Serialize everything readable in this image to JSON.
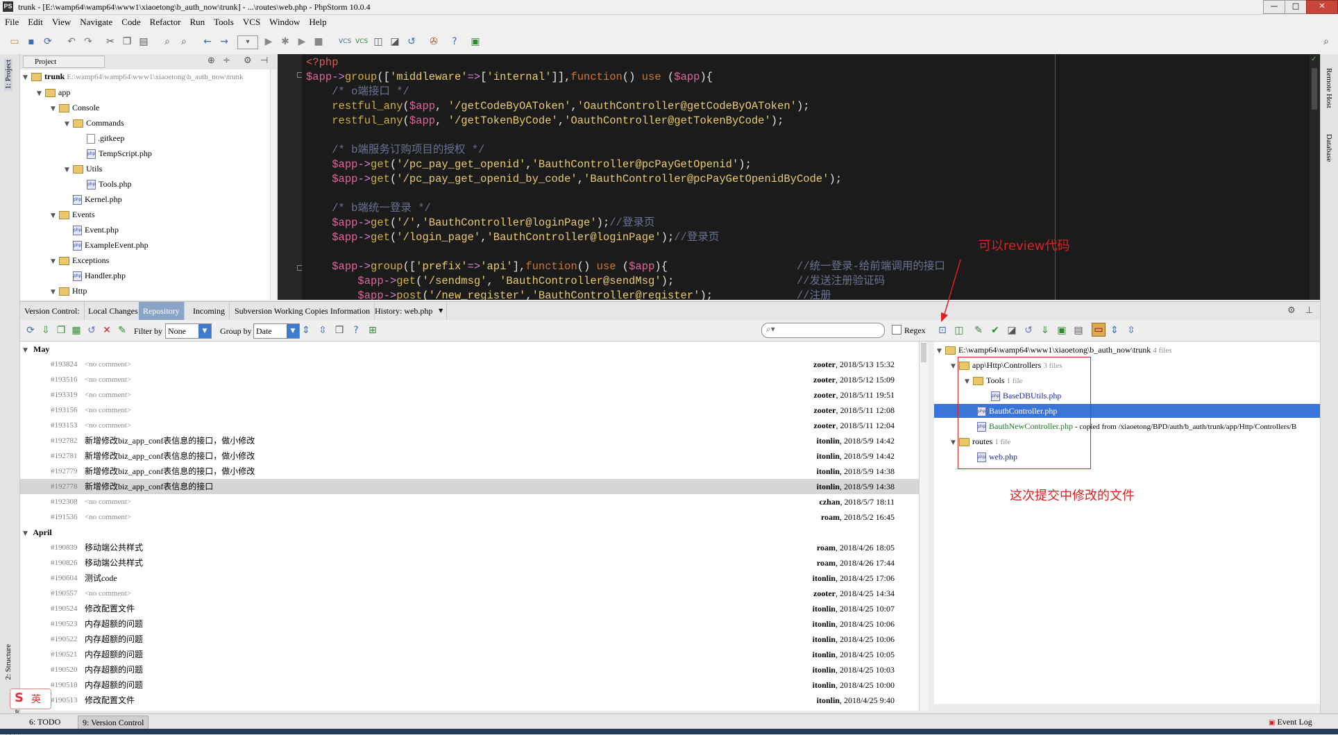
{
  "window": {
    "title": "trunk - [E:\\wamp64\\wamp64\\www1\\xiaoetong\\b_auth_now\\trunk] - ...\\routes\\web.php - PhpStorm 10.0.4",
    "app_icon": "PS",
    "controls": [
      "minimize-icon",
      "maximize-icon",
      "close-icon"
    ]
  },
  "menu": [
    "File",
    "Edit",
    "View",
    "Navigate",
    "Code",
    "Refactor",
    "Run",
    "Tools",
    "VCS",
    "Window",
    "Help"
  ],
  "left_strip": {
    "project_tab": "1: Project",
    "structure_tab": "2: Structure",
    "favorites_tab": "2: Favorites"
  },
  "right_strip": {
    "remote_host_tab": "Remote Host",
    "database_tab": "Database"
  },
  "project_panel": {
    "header": "Project",
    "tree": [
      {
        "label": "trunk",
        "extra": "E:\\wamp64\\wamp64\\www1\\xiaoetong\\b_auth_now\\trunk",
        "type": "root"
      },
      {
        "label": "app",
        "type": "folder"
      },
      {
        "label": "Console",
        "type": "folder"
      },
      {
        "label": "Commands",
        "type": "folder"
      },
      {
        "label": ".gitkeep",
        "type": "file"
      },
      {
        "label": "TempScript.php",
        "type": "php"
      },
      {
        "label": "Utils",
        "type": "folder"
      },
      {
        "label": "Tools.php",
        "type": "php"
      },
      {
        "label": "Kernel.php",
        "type": "php"
      },
      {
        "label": "Events",
        "type": "folder"
      },
      {
        "label": "Event.php",
        "type": "php"
      },
      {
        "label": "ExampleEvent.php",
        "type": "php"
      },
      {
        "label": "Exceptions",
        "type": "folder"
      },
      {
        "label": "Handler.php",
        "type": "php"
      },
      {
        "label": "Http",
        "type": "folder"
      }
    ]
  },
  "editor": {
    "lines": [
      "<?php",
      "$app->group(['middleware'=>['internal']],function() use ($app){",
      "    /* o端接口 */",
      "    restful_any($app, '/getCodeByOAToken','OauthController@getCodeByOAToken');",
      "    restful_any($app, '/getTokenByCode','OauthController@getTokenByCode');",
      "",
      "    /* b端服务订购项目的授权 */",
      "    $app->get('/pc_pay_get_openid','BauthController@pcPayGetOpenid');",
      "    $app->get('/pc_pay_get_openid_by_code','BauthController@pcPayGetOpenidByCode');",
      "",
      "    /* b端统一登录 */",
      "    $app->get('/','BauthController@loginPage');//登录页",
      "    $app->get('/login_page','BauthController@loginPage');//登录页",
      "",
      "    $app->group(['prefix'=>'api'],function() use ($app){                    //统一登录-给前端调用的接口",
      "        $app->get('/sendmsg', 'BauthController@sendMsg');                   //发送注册验证码",
      "        $app->post('/new_register','BauthController@register');             //注册"
    ]
  },
  "vc_tabs": [
    "Version Control:",
    "Local Changes",
    "Repository",
    "Incoming",
    "Subversion Working Copies Information",
    "History: web.php"
  ],
  "vc_toolbar": {
    "filter_label": "Filter by",
    "filter_value": "None",
    "group_label": "Group by",
    "group_value": "Date",
    "search_placeholder": "",
    "regex_label": "Regex"
  },
  "commits": {
    "groups": [
      {
        "name": "May",
        "rows": [
          {
            "rev": "#193824",
            "msg": "<no comment>",
            "author": "zooter",
            "date": ", 2018/5/13 15:32",
            "nc": true
          },
          {
            "rev": "#193516",
            "msg": "<no comment>",
            "author": "zooter",
            "date": ", 2018/5/12 15:09",
            "nc": true
          },
          {
            "rev": "#193319",
            "msg": "<no comment>",
            "author": "zooter",
            "date": ", 2018/5/11 19:51",
            "nc": true
          },
          {
            "rev": "#193156",
            "msg": "<no comment>",
            "author": "zooter",
            "date": ", 2018/5/11 12:08",
            "nc": true
          },
          {
            "rev": "#193153",
            "msg": "<no comment>",
            "author": "zooter",
            "date": ", 2018/5/11 12:04",
            "nc": true
          },
          {
            "rev": "#192782",
            "msg": "新增修改biz_app_conf表信息的接口，做小修改",
            "author": "itonlin",
            "date": ", 2018/5/9 14:42",
            "nc": false
          },
          {
            "rev": "#192781",
            "msg": "新增修改biz_app_conf表信息的接口，做小修改",
            "author": "itonlin",
            "date": ", 2018/5/9 14:42",
            "nc": false
          },
          {
            "rev": "#192779",
            "msg": "新增修改biz_app_conf表信息的接口，做小修改",
            "author": "itonlin",
            "date": ", 2018/5/9 14:38",
            "nc": false
          },
          {
            "rev": "#192778",
            "msg": "新增修改biz_app_conf表信息的接口",
            "author": "itonlin",
            "date": ", 2018/5/9 14:38",
            "nc": false,
            "selected": true
          },
          {
            "rev": "#192308",
            "msg": "<no comment>",
            "author": "czhan",
            "date": ", 2018/5/7 18:11",
            "nc": true
          },
          {
            "rev": "#191536",
            "msg": "<no comment>",
            "author": "roam",
            "date": ", 2018/5/2 16:45",
            "nc": true
          }
        ]
      },
      {
        "name": "April",
        "rows": [
          {
            "rev": "#190839",
            "msg": "移动端公共样式",
            "author": "roam",
            "date": ", 2018/4/26 18:05",
            "nc": false
          },
          {
            "rev": "#190826",
            "msg": "移动端公共样式",
            "author": "roam",
            "date": ", 2018/4/26 17:44",
            "nc": false
          },
          {
            "rev": "#190604",
            "msg": "测试code",
            "author": "itonlin",
            "date": ", 2018/4/25 17:06",
            "nc": false
          },
          {
            "rev": "#190557",
            "msg": "<no comment>",
            "author": "zooter",
            "date": ", 2018/4/25 14:34",
            "nc": true
          },
          {
            "rev": "#190524",
            "msg": "修改配置文件",
            "author": "itonlin",
            "date": ", 2018/4/25 10:07",
            "nc": false
          },
          {
            "rev": "#190523",
            "msg": "内存超额的问题",
            "author": "itonlin",
            "date": ", 2018/4/25 10:06",
            "nc": false
          },
          {
            "rev": "#190522",
            "msg": "内存超额的问题",
            "author": "itonlin",
            "date": ", 2018/4/25 10:06",
            "nc": false
          },
          {
            "rev": "#190521",
            "msg": "内存超额的问题",
            "author": "itonlin",
            "date": ", 2018/4/25 10:05",
            "nc": false
          },
          {
            "rev": "#190520",
            "msg": "内存超额的问题",
            "author": "itonlin",
            "date": ", 2018/4/25 10:03",
            "nc": false
          },
          {
            "rev": "#190518",
            "msg": "内存超额的问题",
            "author": "itonlin",
            "date": ", 2018/4/25 10:00",
            "nc": false
          },
          {
            "rev": "#190513",
            "msg": "修改配置文件",
            "author": "itonlin",
            "date": ", 2018/4/25 9:40",
            "nc": false
          }
        ]
      }
    ]
  },
  "changed_files": {
    "root": "E:\\wamp64\\wamp64\\www1\\xiaoetong\\b_auth_now\\trunk",
    "root_count": "4 files",
    "controllers_dir": "app\\Http\\Controllers",
    "controllers_count": "3 files",
    "tools_dir": "Tools",
    "tools_count": "1 file",
    "file_basedb": "BaseDBUtils.php",
    "file_bauth": "BauthController.php",
    "file_bauthnew": "BauthNewController.php",
    "copied_note": "- copied from /xiaoetong/BPD/auth/b_auth/trunk/app/Http/Controllers/B",
    "routes_dir": "routes",
    "routes_count": "1 file",
    "file_web": "web.php"
  },
  "annotations": {
    "review": "可以review代码",
    "changed": "这次提交中修改的文件"
  },
  "bottom_tabs": [
    "6: TODO",
    "9: Version Control"
  ],
  "event_log": "Event Log",
  "ime": "英",
  "colors": {
    "selection": "#3875d7",
    "annotation": "#e02020",
    "editor_bg": "#1b1b1b"
  }
}
